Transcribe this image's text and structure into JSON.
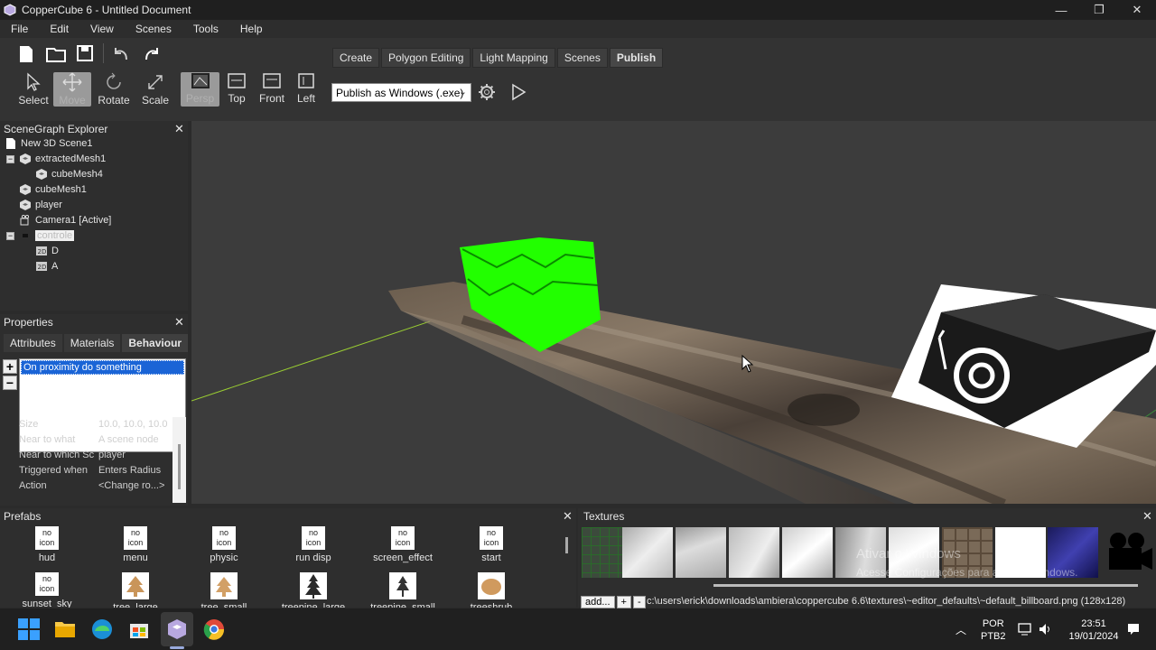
{
  "window": {
    "title": "CopperCube 6 - Untitled Document",
    "controls": [
      "minimize",
      "maximize",
      "close"
    ]
  },
  "menu": [
    "File",
    "Edit",
    "View",
    "Scenes",
    "Tools",
    "Help"
  ],
  "toolbar": {
    "tools": [
      {
        "label": "Select",
        "icon": "cursor-icon"
      },
      {
        "label": "Move",
        "icon": "move-icon",
        "selected": true
      },
      {
        "label": "Rotate",
        "icon": "rotate-icon"
      },
      {
        "label": "Scale",
        "icon": "scale-icon"
      }
    ],
    "views": [
      {
        "label": "Persp",
        "selected": true
      },
      {
        "label": "Top"
      },
      {
        "label": "Front"
      },
      {
        "label": "Left"
      }
    ],
    "tabs": [
      "Create",
      "Polygon Editing",
      "Light Mapping",
      "Scenes",
      "Publish"
    ],
    "active_tab": "Publish",
    "publish_target": "Publish as Windows (.exe)"
  },
  "scenegraph": {
    "title": "SceneGraph Explorer",
    "nodes": [
      "New 3D Scene1",
      "extractedMesh1",
      "cubeMesh4",
      "cubeMesh1",
      "player",
      "Camera1 [Active]",
      "controle",
      "D",
      "A"
    ]
  },
  "properties": {
    "title": "Properties",
    "tabs": [
      "Attributes",
      "Materials",
      "Behaviour"
    ],
    "active_tab": "Behaviour",
    "behaviours": [
      "On proximity do something"
    ],
    "rows": [
      {
        "key": "Size",
        "value": "10.0, 10.0, 10.0"
      },
      {
        "key": "Near to what",
        "value": "A scene node"
      },
      {
        "key": "Near to which Sc",
        "value": "player"
      },
      {
        "key": "Triggered when",
        "value": "Enters Radius"
      },
      {
        "key": "Action",
        "value": "<Change ro...>"
      }
    ]
  },
  "prefabs": {
    "title": "Prefabs",
    "items": [
      {
        "label": "hud",
        "icon_text": "no icon"
      },
      {
        "label": "menu",
        "icon_text": "no icon"
      },
      {
        "label": "physic",
        "icon_text": "no icon"
      },
      {
        "label": "run disp",
        "icon_text": "no icon"
      },
      {
        "label": "screen_effect",
        "icon_text": "no icon"
      },
      {
        "label": "start",
        "icon_text": "no icon"
      },
      {
        "label": "sunset_sky",
        "icon_text": "no icon"
      },
      {
        "label": "tree_large"
      },
      {
        "label": "tree_small"
      },
      {
        "label": "treepine_large"
      },
      {
        "label": "treepine_small"
      },
      {
        "label": "treeshrub"
      }
    ]
  },
  "textures": {
    "title": "Textures",
    "buttons": [
      "add...",
      "+",
      "-"
    ],
    "path": "c:\\users\\erick\\downloads\\ambiera\\coppercube 6.6\\textures\\~editor_defaults\\~default_billboard.png (128x128)"
  },
  "watermark": {
    "line1": "Ativar o Windows",
    "line2": "Acesse Configurações para ativar o Windows."
  },
  "taskbar": {
    "lang": "POR",
    "layout": "PTB2",
    "time": "23:51",
    "date": "19/01/2024"
  }
}
